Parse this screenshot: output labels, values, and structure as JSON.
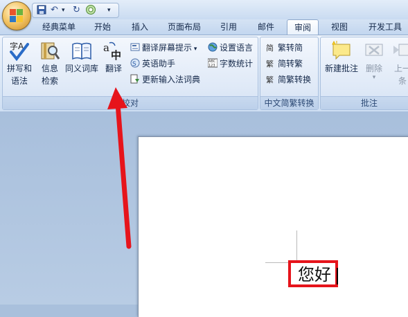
{
  "quick_access": {
    "undo": "↶",
    "dropdown": "▾",
    "redo": "↻",
    "customize": "▾"
  },
  "tabs": [
    "经典菜单",
    "开始",
    "插入",
    "页面布局",
    "引用",
    "邮件",
    "审阅",
    "视图",
    "开发工具"
  ],
  "active_tab": "审阅",
  "groups": {
    "proofing": {
      "label": "校对",
      "spelling": [
        "拼写和",
        "语法"
      ],
      "research": [
        "信息",
        "检索"
      ],
      "thesaurus": "同义词库",
      "translate": "翻译",
      "translate_tip": "翻译屏幕提示",
      "set_language": "设置语言",
      "english_assistant": "英语助手",
      "word_count": "字数统计",
      "update_ime": "更新输入法词典"
    },
    "chinese_conversion": {
      "label": "中文简繁转换",
      "to_simplified": "繁转简",
      "to_traditional": "简转繁",
      "convert": "简繁转换"
    },
    "comments": {
      "label": "批注",
      "new_comment": "新建批注",
      "delete": "删除",
      "previous": [
        "上一",
        "条"
      ]
    }
  },
  "document": {
    "text": "您好"
  },
  "colors": {
    "highlight": "#e6141b",
    "arrow": "#e6141b",
    "ribbon_text": "#15294a"
  }
}
